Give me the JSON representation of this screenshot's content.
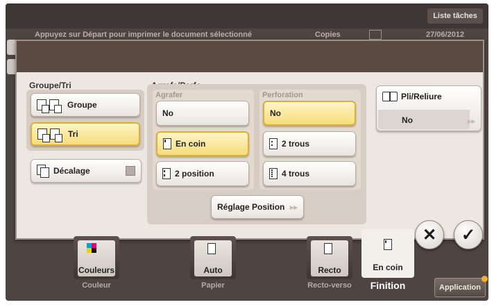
{
  "header": {
    "task_list_label": "Liste tâches",
    "status_message": "Appuyez sur Départ pour imprimer le document sélectionné",
    "copies_label": "Copies",
    "date": "27/06/2012"
  },
  "groupe_tri": {
    "title": "Groupe/Tri",
    "groupe_label": "Groupe",
    "tri_label": "Tri",
    "decalage_label": "Décalage"
  },
  "agrafe_perfo": {
    "title": "Agrafe/Perfo",
    "agrafer_title": "Agrafer",
    "agrafer_options": [
      "No",
      "En coin",
      "2 position"
    ],
    "perforation_title": "Perforation",
    "perforation_options": [
      "No",
      "2 trous",
      "4 trous"
    ],
    "reglage_label": "Réglage Position"
  },
  "pli_reliure": {
    "title": "Pli/Reliure",
    "value": "No"
  },
  "bottom_bar": {
    "keys": [
      {
        "value": "Couleurs",
        "caption": "Couleur"
      },
      {
        "value": "Auto",
        "caption": "Papier"
      },
      {
        "value": "Recto",
        "caption": "Recto-verso"
      },
      {
        "value": "En coin",
        "caption": "Finition"
      }
    ],
    "application_label": "Application"
  },
  "colors": {
    "selected_fill": "#f6dc7a",
    "selected_border": "#dcae3a",
    "background": "#4e4542"
  }
}
